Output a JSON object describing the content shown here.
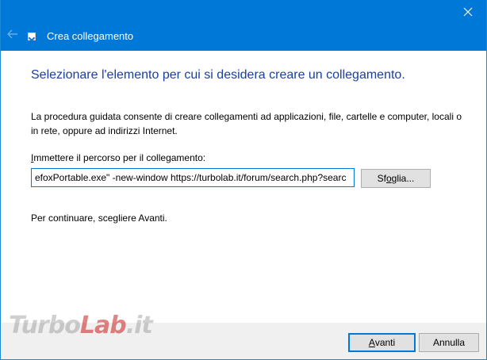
{
  "window": {
    "title": "Crea collegamento",
    "accent_color": "#0078d7",
    "close_icon": "close-icon",
    "back_icon": "back-arrow-icon"
  },
  "content": {
    "heading": "Selezionare l'elemento per cui si desidera creare un collegamento.",
    "description": "La procedura guidata consente di creare collegamenti ad applicazioni, file, cartelle e computer, locali o in rete, oppure ad indirizzi Internet.",
    "path_label_access_key": "I",
    "path_label_rest": "mmettere il percorso per il collegamento:",
    "path_value": "efoxPortable.exe\" -new-window https://turbolab.it/forum/search.php?searc",
    "browse_access_key": "o",
    "browse_prefix": "Sf",
    "browse_suffix": "glia...",
    "continue_text": "Per continuare, scegliere Avanti."
  },
  "footer": {
    "next_access_key": "A",
    "next_rest": "vanti",
    "cancel_label": "Annulla"
  },
  "watermark": {
    "part1": "Turbo",
    "part2": "Lab",
    "part3": ".it"
  }
}
